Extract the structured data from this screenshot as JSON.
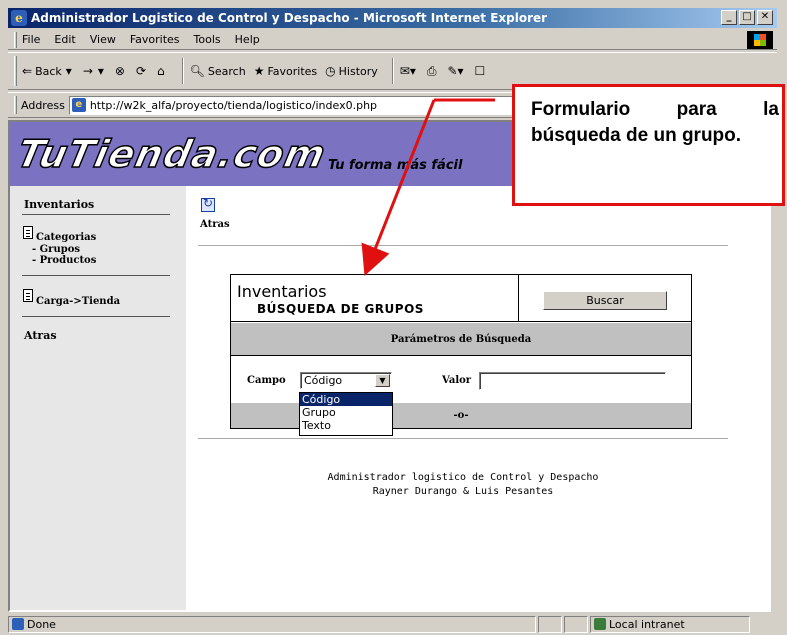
{
  "window": {
    "title": "Administrador Logistico de Control y Despacho - Microsoft Internet Explorer",
    "minimize": "_",
    "maximize": "□",
    "close": "✕"
  },
  "menu": [
    "File",
    "Edit",
    "View",
    "Favorites",
    "Tools",
    "Help"
  ],
  "toolbar": {
    "back": "Back",
    "forward": "→",
    "search": "Search",
    "favorites": "Favorites",
    "history": "History"
  },
  "address": {
    "label": "Address",
    "url": "http://w2k_alfa/proyecto/tienda/logistico/index0.php"
  },
  "banner": {
    "logo": "TuTienda.com",
    "tagline": "Tu forma más fácil"
  },
  "sidebar": {
    "inventarios": "Inventarios",
    "categorias": "Categorias",
    "grupos": "- Grupos",
    "productos": "- Productos",
    "carga": "Carga->Tienda",
    "atras": "Atras"
  },
  "main": {
    "back_label": "Atras",
    "form": {
      "title": "Inventarios",
      "subtitle": "BÚSQUEDA DE GRUPOS",
      "search_button": "Buscar",
      "params_header": "Parámetros de Búsqueda",
      "campo_label": "Campo",
      "campo_value": "Código",
      "campo_options": [
        "Código",
        "Grupo",
        "Texto"
      ],
      "valor_label": "Valor",
      "valor_value": "",
      "bottom_text": "-o-"
    },
    "footer_line1": "Administrador logistico de Control y Despacho",
    "footer_line2": "Rayner Durango & Luis Pesantes"
  },
  "status": {
    "text": "Done",
    "zone": "Local intranet"
  },
  "callout": {
    "text": "Formulario para la búsqueda de un grupo.",
    "border_color": "#e01010"
  }
}
